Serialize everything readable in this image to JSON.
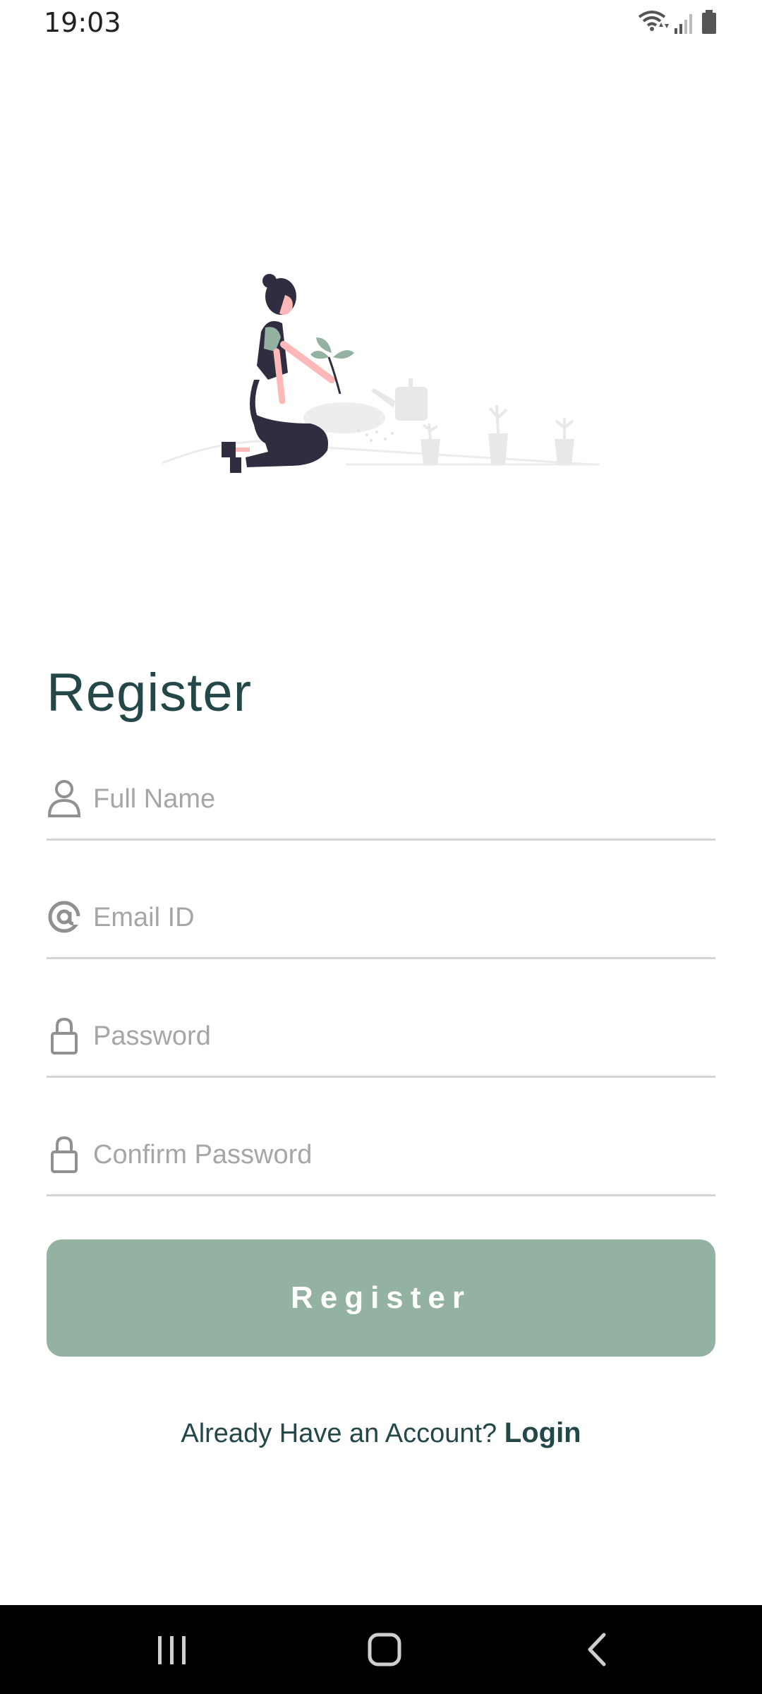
{
  "status_bar": {
    "time": "19:03"
  },
  "icons": {
    "wifi": "wifi-icon",
    "signal": "signal-icon",
    "battery": "battery-icon",
    "user": "user-icon",
    "at": "at-sign-icon",
    "lock": "lock-icon",
    "recent_apps": "recent-apps-icon",
    "home": "home-icon",
    "back": "back-icon"
  },
  "register_form": {
    "title": "Register",
    "full_name_placeholder": "Full Name",
    "email_placeholder": "Email ID",
    "password_placeholder": "Password",
    "confirm_password_placeholder": "Confirm Password",
    "submit_label": "Register",
    "login_prompt": "Already Have an Account?",
    "login_link": "Login"
  },
  "colors": {
    "primary_text": "#244749",
    "button_background": "#93b2a1",
    "button_text": "#ffffff",
    "placeholder": "#a6a6a6",
    "underline": "#d4d4d4",
    "illustration_dark": "#2f2e41",
    "illustration_green": "#93b2a1",
    "illustration_skin": "#ffb8b8",
    "nav_bar": "#000000"
  }
}
